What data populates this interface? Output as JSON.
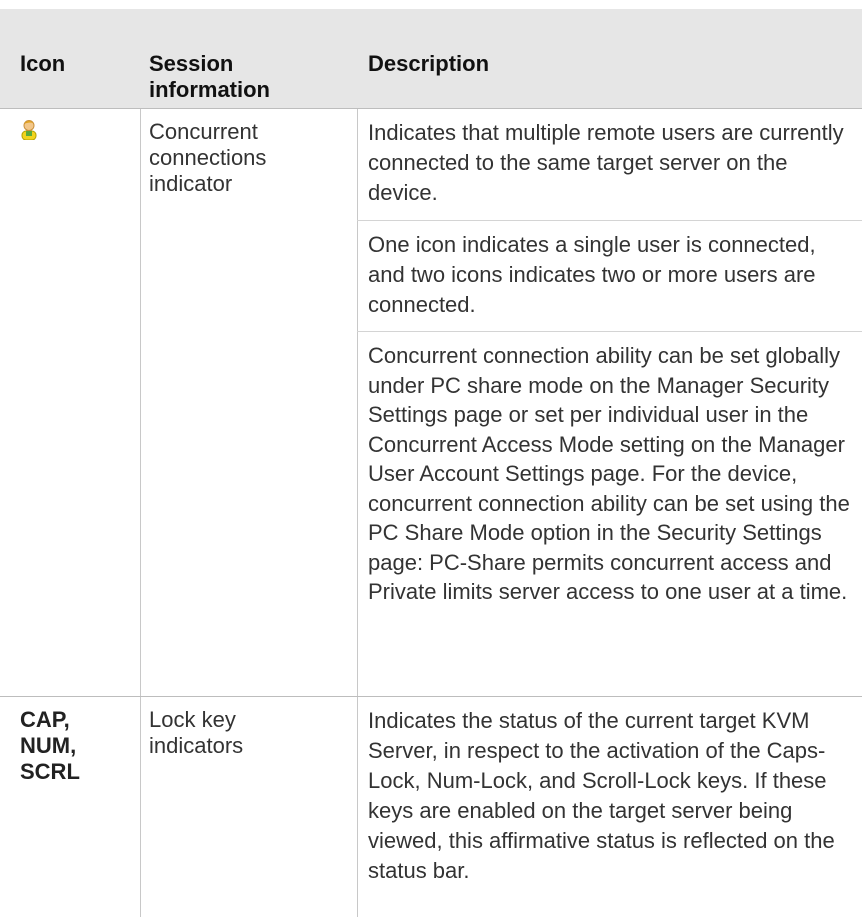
{
  "header": {
    "icon": "Icon",
    "session_line1": "Session",
    "session_line2": "information",
    "description": "Description"
  },
  "rows": [
    {
      "icon_name": "user-icon",
      "session_line1": "Concurrent",
      "session_line2": "connections",
      "session_line3": "indicator",
      "paragraphs": [
        "Indicates that multiple remote users are currently connected to the same target server on the device.",
        "One icon indicates a single user is connected, and two icons indicates two or more users are connected.",
        "Concurrent connection ability can be set globally under PC share mode on the Manager Security Settings page or set per individual user in the Concurrent Access Mode setting on the Manager User Account Settings page. For the device, concurrent connection ability can be set using the PC Share Mode option in the Security Settings page: PC-Share permits concurrent access and Private limits server access to one user at a time."
      ]
    },
    {
      "icon_line1": "CAP,",
      "icon_line2": "NUM,",
      "icon_line3": "SCRL",
      "session_line1": "Lock key",
      "session_line2": "indicators",
      "paragraphs": [
        "Indicates the status of the current target KVM Server, in respect to the activation of the Caps-Lock, Num-Lock, and Scroll-Lock keys. If these keys are enabled on the target server being viewed, this affirmative status is reflected on the status bar."
      ]
    }
  ]
}
